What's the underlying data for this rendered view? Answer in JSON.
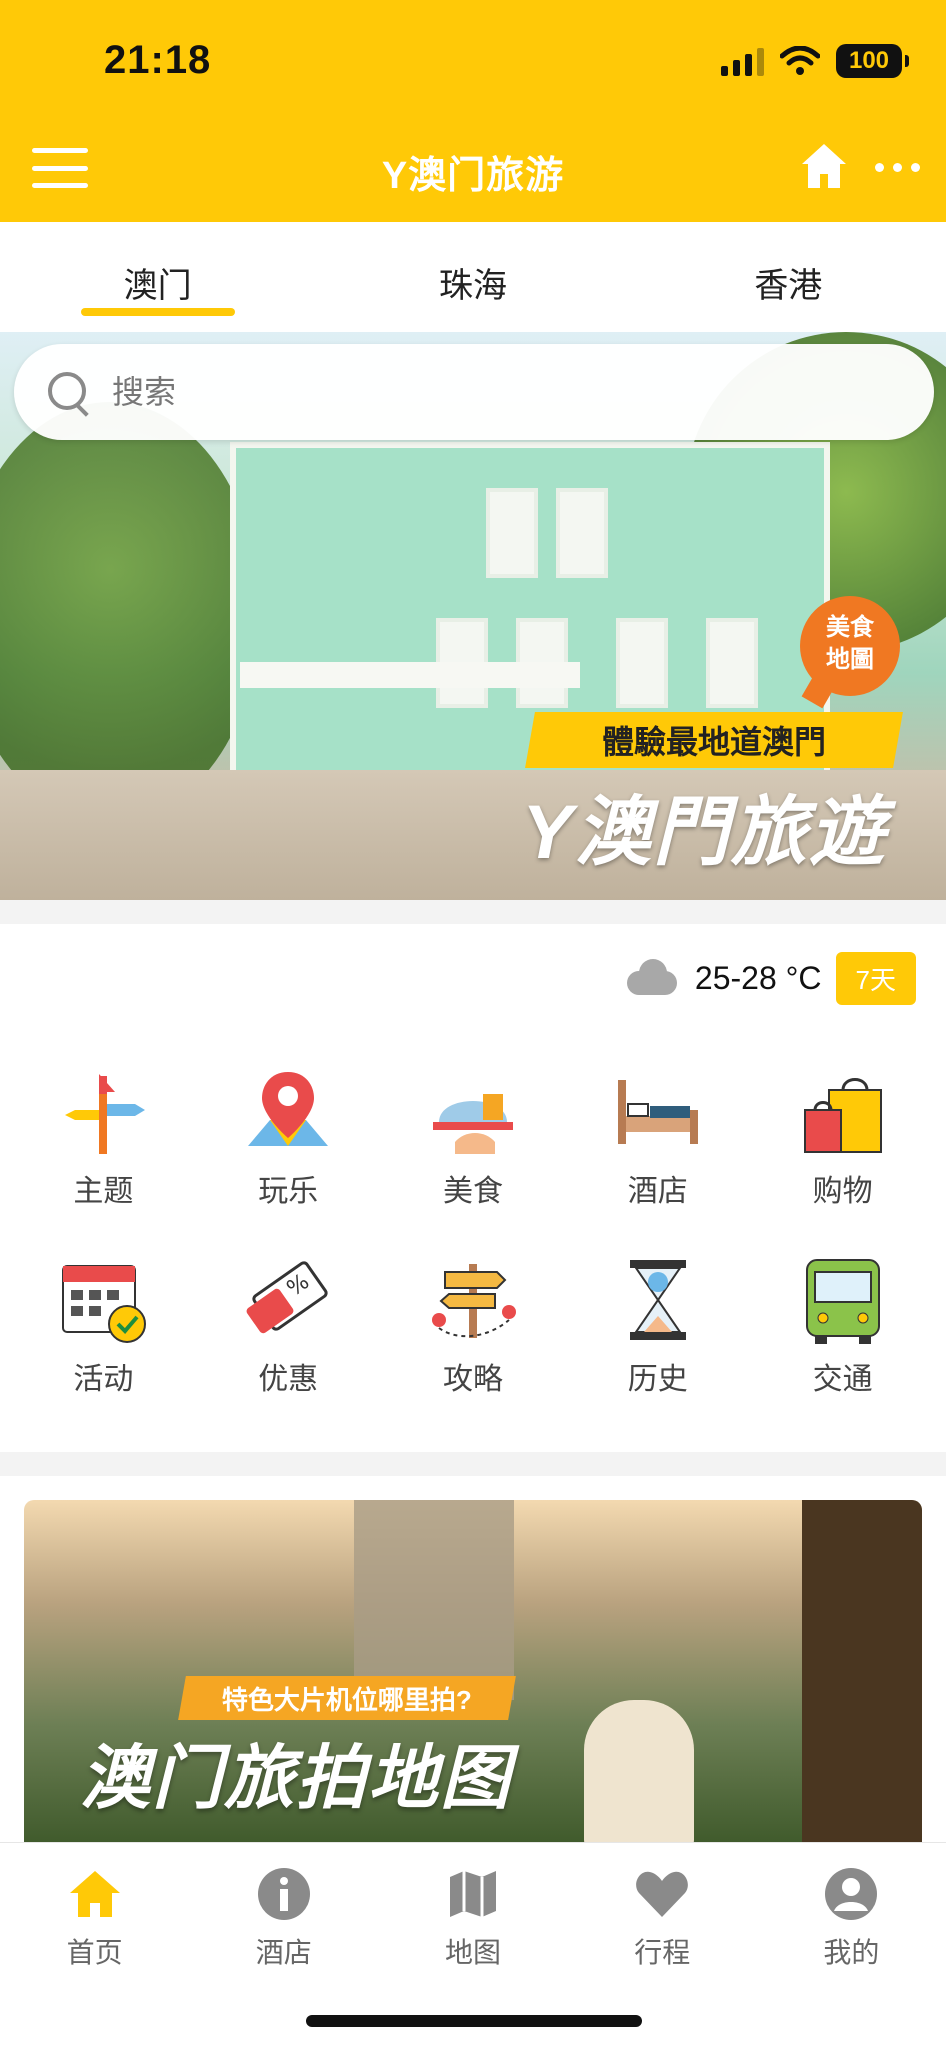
{
  "status_bar": {
    "time": "21:18",
    "battery": "100"
  },
  "header": {
    "title": "Y澳门旅游",
    "menu_icon": "menu-icon",
    "home_icon": "home-icon",
    "more_icon": "more-icon"
  },
  "city_tabs": [
    {
      "label": "澳门",
      "active": true
    },
    {
      "label": "珠海",
      "active": false
    },
    {
      "label": "香港",
      "active": false
    }
  ],
  "search": {
    "placeholder": "搜索"
  },
  "hero": {
    "badge": "美食\n地圖",
    "badge_line1": "美食",
    "badge_line2": "地圖",
    "slogan": "體驗最地道澳門",
    "brand": "Y澳門旅遊"
  },
  "weather": {
    "icon": "cloud-rain-icon",
    "temp": "25-28 °C",
    "forecast_label": "7天"
  },
  "categories": [
    {
      "label": "主题",
      "icon": "direction-signs-icon"
    },
    {
      "label": "玩乐",
      "icon": "map-pin-icon"
    },
    {
      "label": "美食",
      "icon": "food-tray-icon"
    },
    {
      "label": "酒店",
      "icon": "bed-icon"
    },
    {
      "label": "购物",
      "icon": "shopping-bags-icon"
    },
    {
      "label": "活动",
      "icon": "calendar-check-icon"
    },
    {
      "label": "优惠",
      "icon": "discount-ticket-icon"
    },
    {
      "label": "攻略",
      "icon": "signpost-icon"
    },
    {
      "label": "历史",
      "icon": "hourglass-icon"
    },
    {
      "label": "交通",
      "icon": "bus-icon"
    }
  ],
  "promo": {
    "tag": "特色大片机位哪里拍?",
    "title": "澳门旅拍地图"
  },
  "bottom_nav": [
    {
      "label": "首页",
      "icon": "home-icon",
      "active": true
    },
    {
      "label": "酒店",
      "icon": "info-icon",
      "active": false
    },
    {
      "label": "地图",
      "icon": "map-icon",
      "active": false
    },
    {
      "label": "行程",
      "icon": "heart-icon",
      "active": false
    },
    {
      "label": "我的",
      "icon": "user-icon",
      "active": false
    }
  ],
  "colors": {
    "brand_yellow": "#FFC907",
    "promo_orange": "#F5A623",
    "badge_orange": "#F07822",
    "inactive_gray": "#8a8a8a"
  }
}
